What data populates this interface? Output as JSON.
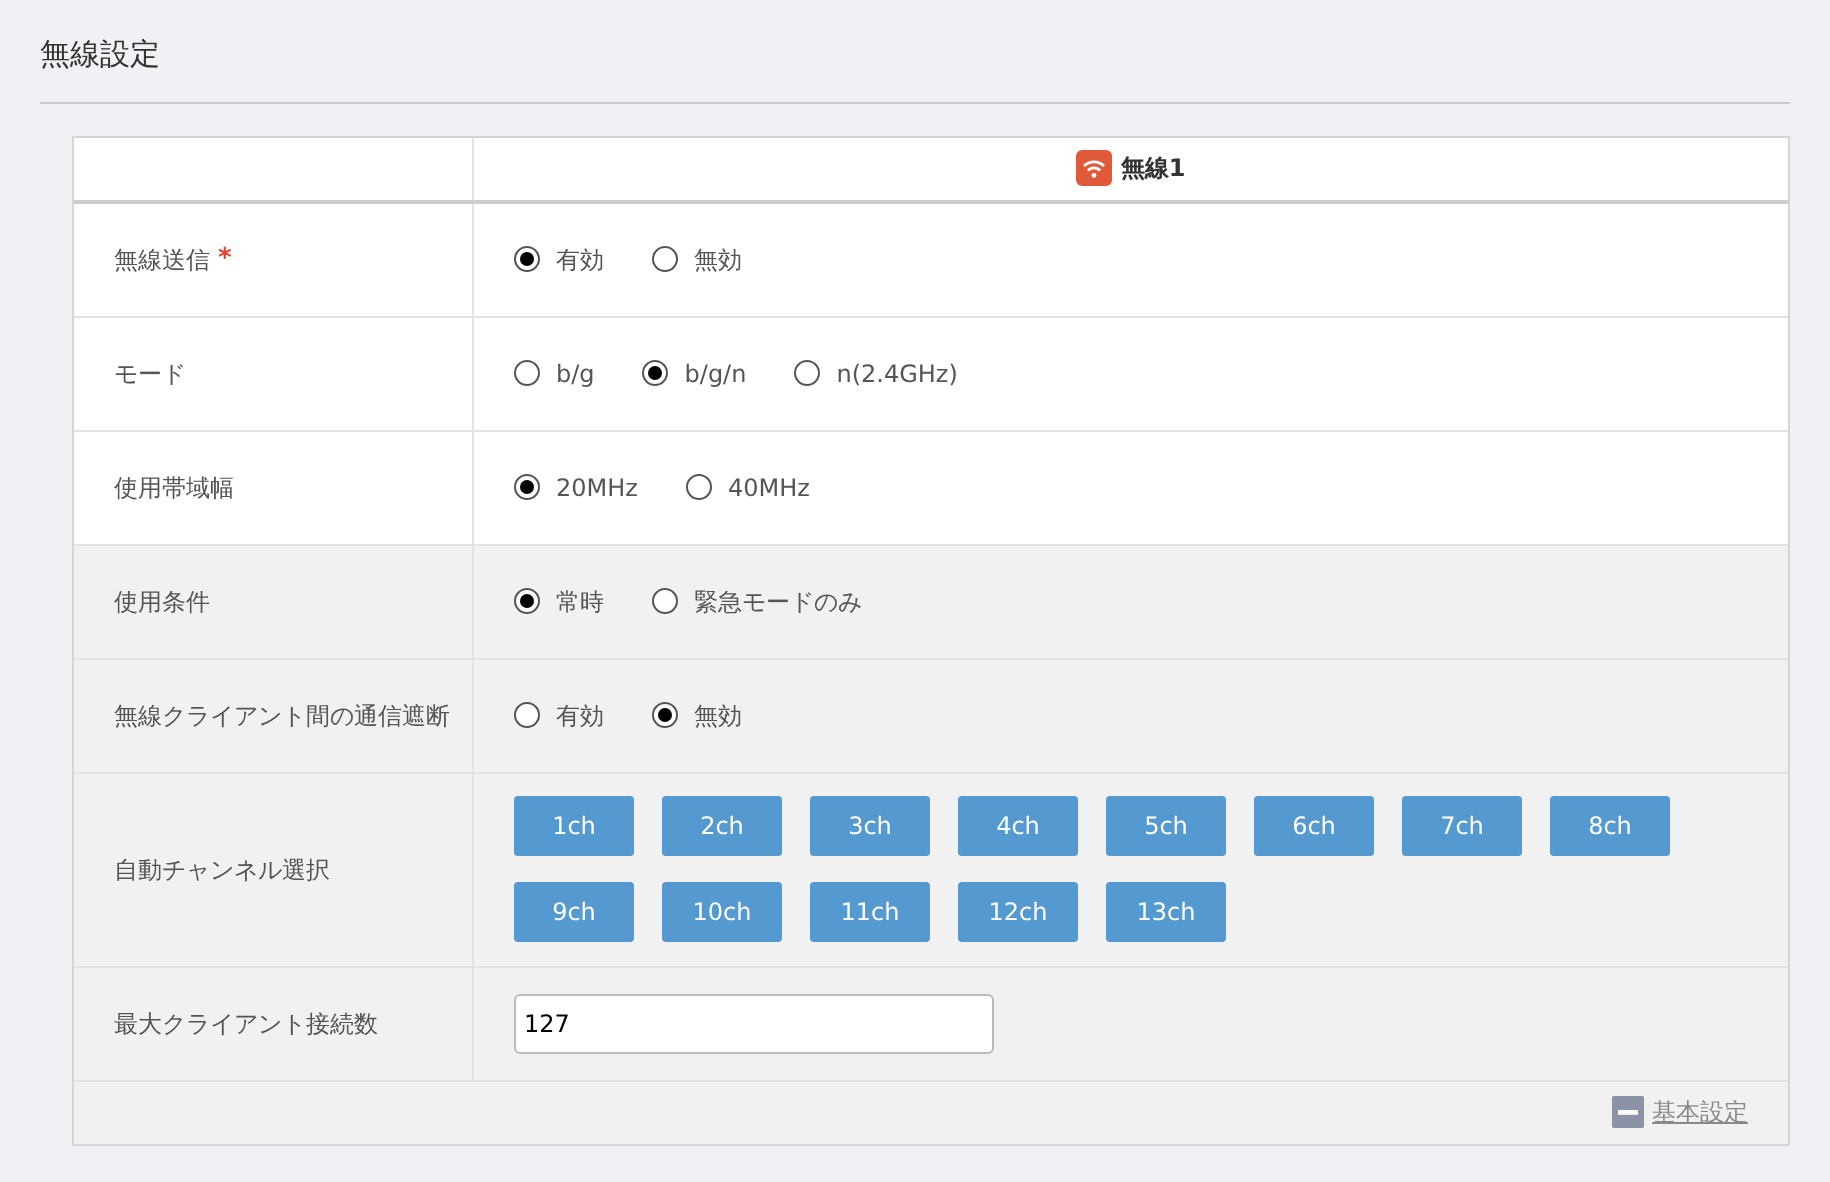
{
  "title": "無線設定",
  "table": {
    "header": "無線1",
    "rows": [
      {
        "label": "無線送信",
        "required_mark": "*",
        "shaded": false,
        "kind": "radio",
        "options": [
          {
            "label": "有効",
            "selected": true
          },
          {
            "label": "無効",
            "selected": false
          }
        ]
      },
      {
        "label": "モード",
        "shaded": false,
        "kind": "radio",
        "options": [
          {
            "label": "b/g",
            "selected": false
          },
          {
            "label": "b/g/n",
            "selected": true
          },
          {
            "label": "n(2.4GHz)",
            "selected": false
          }
        ]
      },
      {
        "label": "使用帯域幅",
        "shaded": false,
        "kind": "radio",
        "options": [
          {
            "label": "20MHz",
            "selected": true
          },
          {
            "label": "40MHz",
            "selected": false
          }
        ]
      },
      {
        "label": "使用条件",
        "shaded": true,
        "kind": "radio",
        "options": [
          {
            "label": "常時",
            "selected": true
          },
          {
            "label": "緊急モードのみ",
            "selected": false
          }
        ]
      },
      {
        "label": "無線クライアント間の通信遮断",
        "shaded": true,
        "kind": "radio",
        "options": [
          {
            "label": "有効",
            "selected": false
          },
          {
            "label": "無効",
            "selected": true
          }
        ]
      },
      {
        "label": "自動チャンネル選択",
        "shaded": true,
        "kind": "channels",
        "channels": [
          "1ch",
          "2ch",
          "3ch",
          "4ch",
          "5ch",
          "6ch",
          "7ch",
          "8ch",
          "9ch",
          "10ch",
          "11ch",
          "12ch",
          "13ch"
        ]
      },
      {
        "label": "最大クライアント接続数",
        "shaded": true,
        "kind": "input",
        "value": "127"
      }
    ]
  },
  "footer_link": "基本設定"
}
